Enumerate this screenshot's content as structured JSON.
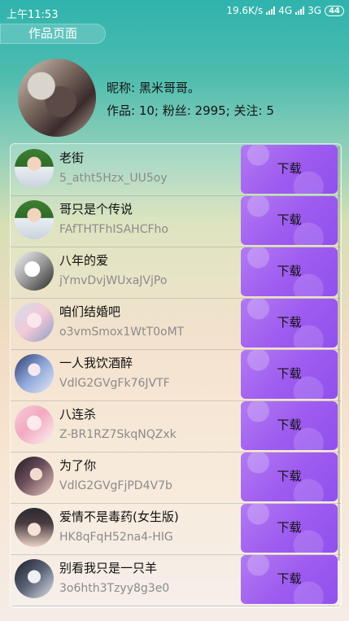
{
  "status_bar": {
    "time": "上午11:53",
    "speed": "19.6K/s",
    "net1": "4G",
    "net2": "3G",
    "battery": "44"
  },
  "page_tab": "作品页面",
  "profile": {
    "nickname": "昵称: 黑米哥哥。",
    "stats": "作品: 10; 粉丝: 2995; 关注: 5"
  },
  "download_label": "下载",
  "items": [
    {
      "title": "老街",
      "id": "5_atht5Hzx_UU5oy"
    },
    {
      "title": "哥只是个传说",
      "id": "FAfTHTFhISAHCFho"
    },
    {
      "title": "八年的爱",
      "id": "jYmvDvjWUxaJVjPo"
    },
    {
      "title": "咱们结婚吧",
      "id": "o3vmSmox1WtT0oMT"
    },
    {
      "title": "一人我饮酒醉",
      "id": "VdlG2GVgFk76JVTF"
    },
    {
      "title": "八连杀",
      "id": "Z-BR1RZ7SkqNQZxk"
    },
    {
      "title": "为了你",
      "id": "VdlG2GVgFjPD4V7b"
    },
    {
      "title": "爱情不是毒药(女生版)",
      "id": "HK8qFqH52na4-HIG"
    },
    {
      "title": "别看我只是一只羊",
      "id": "3o6hth3Tzyy8g3e0"
    }
  ]
}
